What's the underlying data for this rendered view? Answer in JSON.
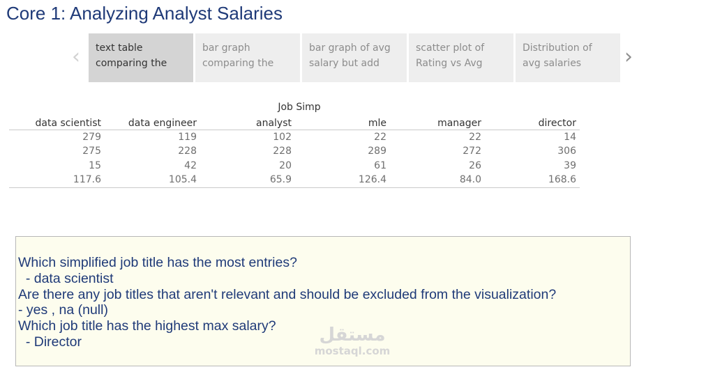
{
  "page": {
    "title": "Core 1: Analyzing Analyst Salaries"
  },
  "nav": {
    "prev_glyph": "‹",
    "next_glyph": "›"
  },
  "tabs": [
    {
      "line1": "text table",
      "line2": "comparing the",
      "active": true
    },
    {
      "line1": "bar graph",
      "line2": "comparing the",
      "active": false
    },
    {
      "line1": "bar graph of avg",
      "line2": "salary but add",
      "active": false
    },
    {
      "line1": "scatter plot of",
      "line2": "Rating vs Avg",
      "active": false
    },
    {
      "line1": "Distribution of",
      "line2": "avg salaries",
      "active": false
    }
  ],
  "table": {
    "group_header": "Job Simp",
    "columns": [
      "data scientist",
      "data engineer",
      "analyst",
      "mle",
      "manager",
      "director"
    ],
    "rows": [
      [
        "279",
        "119",
        "102",
        "22",
        "22",
        "14"
      ],
      [
        "275",
        "228",
        "228",
        "289",
        "272",
        "306"
      ],
      [
        "15",
        "42",
        "20",
        "61",
        "26",
        "39"
      ],
      [
        "117.6",
        "105.4",
        "65.9",
        "126.4",
        "84.0",
        "168.6"
      ]
    ]
  },
  "notes": {
    "lines": [
      "Which simplified job title has the most entries?",
      "  - data scientist",
      "Are there any job titles that aren't relevant and should be excluded from the visualization?",
      "- yes , na (null)",
      "Which job title has the highest max salary?",
      "  - Director"
    ]
  },
  "watermark": {
    "arabic": "مستقل",
    "latin": "mostaql.com"
  },
  "colors": {
    "title": "#1f3a78",
    "note_text": "#1f3a78",
    "note_background": "#fdfdee",
    "tab_active": "#d4d4d4",
    "tab_inactive": "#eeeeee"
  }
}
